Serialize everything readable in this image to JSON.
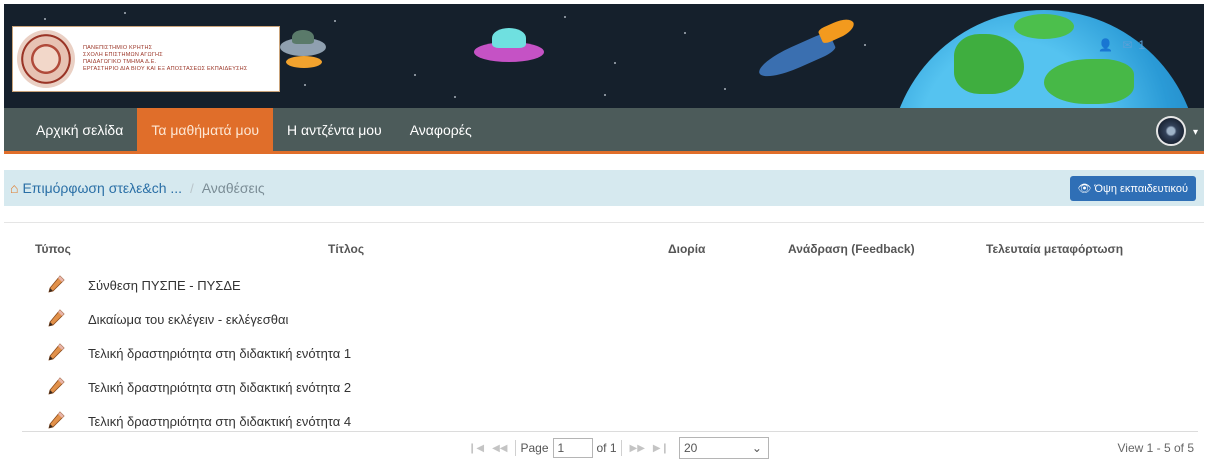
{
  "header": {
    "logo_lines": [
      "ΠΑΝΕΠΙΣΤΗΜΙΟ ΚΡΗΤΗΣ",
      "ΣΧΟΛΗ ΕΠΙΣΤΗΜΩΝ ΑΓΩΓΗΣ",
      "ΠΑΙΔΑΓΩΓΙΚΟ ΤΜΗΜΑ Δ.Ε.",
      "ΕΡΓΑΣΤΗΡΙΟ ΔΙΑ ΒΙΟΥ ΚΑΙ ΕΞ ΑΠΟΣΤΑΣΕΩΣ ΕΚΠΑΙΔΕΥΣΗΣ"
    ],
    "notification_count": "1"
  },
  "navbar": {
    "items": [
      {
        "label": "Αρχική σελίδα",
        "active": false
      },
      {
        "label": "Τα μαθήματά μου",
        "active": true
      },
      {
        "label": "Η αντζέντα μου",
        "active": false
      },
      {
        "label": "Αναφορές",
        "active": false
      }
    ],
    "caret": "▾"
  },
  "breadcrumb": {
    "home_label": "Επιμόρφωση στελε&ch ...",
    "separator": "/",
    "current": "Αναθέσεις"
  },
  "view_button": {
    "label": "Όψη εκπαιδευτικού"
  },
  "table": {
    "headers": [
      "Τύπος",
      "Τίτλος",
      "Διορία",
      "Ανάδραση (Feedback)",
      "Τελευταία μεταφόρτωση"
    ],
    "rows": [
      {
        "icon": "pencil-icon",
        "title": "Σύνθεση ΠΥΣΠΕ - ΠΥΣΔΕ"
      },
      {
        "icon": "pencil-icon",
        "title": "Δικαίωμα του εκλέγειν - εκλέγεσθαι"
      },
      {
        "icon": "pencil-icon",
        "title": "Τελική δραστηριότητα στη διδακτική ενότητα 1"
      },
      {
        "icon": "pencil-icon",
        "title": "Τελική δραστηριότητα στη διδακτική ενότητα 2"
      },
      {
        "icon": "pencil-icon",
        "title": "Τελική δραστηριότητα στη διδακτική ενότητα 4"
      }
    ]
  },
  "pager": {
    "page_label": "Page",
    "page_value": "1",
    "of_label": "of 1",
    "page_size": "20",
    "view_info": "View 1 - 5 of 5"
  },
  "colors": {
    "nav_bg": "#4c5b5a",
    "nav_active": "#e06e2a",
    "breadcrumb_bg": "#d6e9ef",
    "button_blue": "#2f6fb6"
  }
}
